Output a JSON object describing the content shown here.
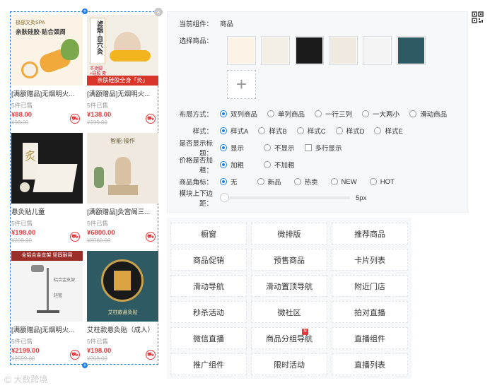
{
  "preview": {
    "products": [
      {
        "name": "[满额赠品]无烟明火...",
        "sold": "5件已售",
        "price": "¥88.00",
        "old_price": "¥98.00"
      },
      {
        "name": "[满额赠品]无烟明火...",
        "sold": "5件已售",
        "price": "¥138.00",
        "old_price": "¥199.00"
      },
      {
        "name": "悬灸贴儿童",
        "sold": "5件已售",
        "price": "¥198.00",
        "old_price": "¥398.00"
      },
      {
        "name": "[满额赠品]灸宫阁三...",
        "sold": "5件已售",
        "price": "¥6800.00",
        "old_price": "¥8980.00"
      },
      {
        "name": "[满额赠品]无烟明火...",
        "sold": "5件已售",
        "price": "¥2199.00",
        "old_price": "¥2599.00"
      },
      {
        "name": "艾柱款悬灸贴（成人）",
        "sold": "5件已售",
        "price": "¥198.00",
        "old_price": "¥268.00"
      }
    ],
    "thumb_texts": {
      "t1_top": "极部文灸SPA",
      "t1_main": "亲肤硅胶·贴合颈周",
      "t2_main": "滤烟·自穴灸",
      "t2_small": "不烫脚+硅胶 素材采购",
      "t2_bottom": "亲肤硅胶全身「灸」",
      "t3_char": "炙",
      "t4_top": "智能·操作",
      "t5_top": "全铝合金支架  坚固耐用",
      "t5_small1": "铝合金支架",
      "t5_small2": "轻管",
      "t6_bottom": "艾柱款悬灸贴"
    }
  },
  "settings": {
    "current_component_label": "当前组件：",
    "current_component_value": "商品",
    "select_products_label": "选择商品：",
    "add_symbol": "+",
    "layout": {
      "label": "布局方式：",
      "options": [
        "双列商品",
        "单列商品",
        "一行三列",
        "一大两小",
        "滑动商品"
      ],
      "selected": 0
    },
    "style": {
      "label": "样式：",
      "options": [
        "样式A",
        "样式B",
        "样式C",
        "样式D",
        "样式E"
      ],
      "selected": 0
    },
    "show_title": {
      "label": "是否显示标题：",
      "options": [
        "显示",
        "不显示"
      ],
      "selected": 0,
      "checkbox": "多行显示"
    },
    "bold_price": {
      "label": "价格是否加粗：",
      "options": [
        "加粗",
        "不加粗"
      ],
      "selected": 0
    },
    "corner_tag": {
      "label": "商品角标：",
      "options": [
        "无",
        "新品",
        "热卖",
        "NEW",
        "HOT"
      ],
      "selected": 0
    },
    "margin": {
      "label": "模块上下边距：",
      "value": "5px"
    }
  },
  "components": [
    "橱窗",
    "微排版",
    "推荐商品",
    "商品促销",
    "预售商品",
    "卡片列表",
    "滑动导航",
    "滑动置顶导航",
    "附近门店",
    "秒杀活动",
    "微社区",
    "拍对直播",
    "微信直播",
    "商品分组导航",
    "直播组件",
    "推广组件",
    "限时活动",
    "直播列表"
  ],
  "components_badge": "N",
  "watermark": "大数跨境",
  "colors": {
    "accent": "#1e7ce6",
    "price": "#e4393c",
    "panel": "#f7f8fa"
  }
}
